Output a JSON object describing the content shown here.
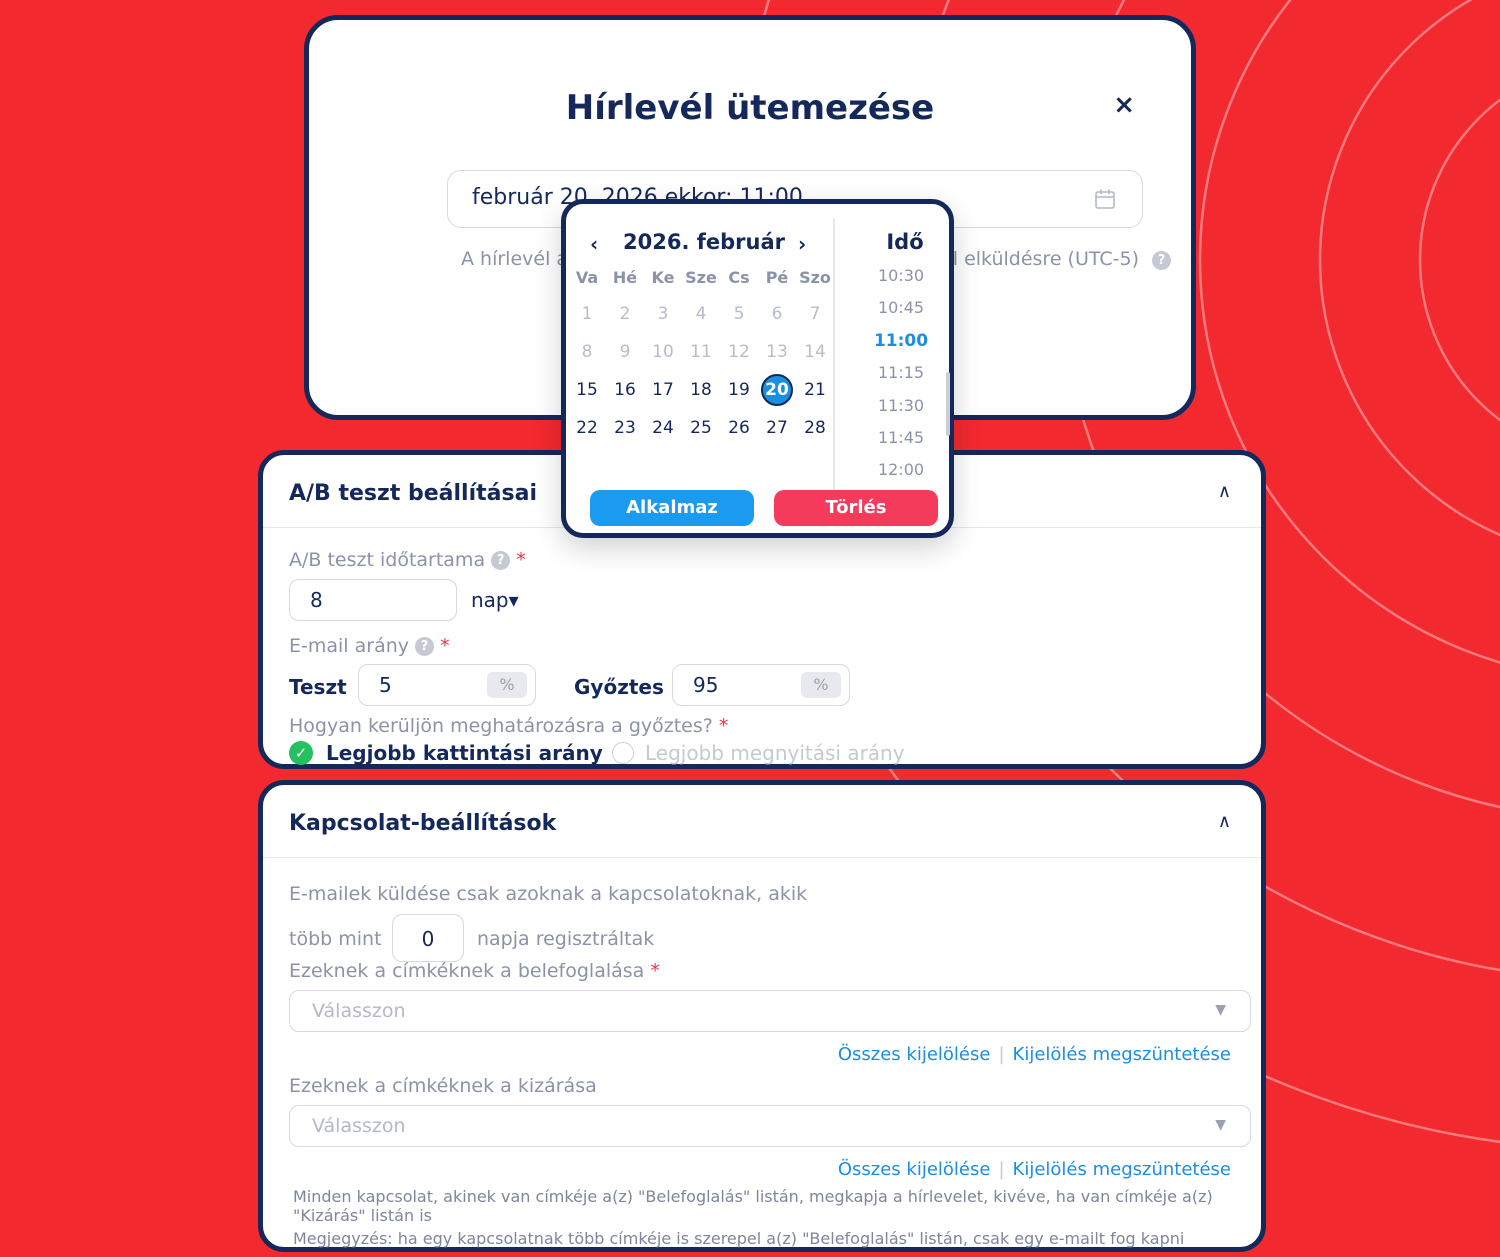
{
  "colors": {
    "background": "#f2292f",
    "navy": "#14285a",
    "accent_blue": "#1a8fe0",
    "danger": "#f43b5c",
    "success": "#25c060"
  },
  "modal": {
    "title": "Hírlevél ütemezése",
    "close_label": "×",
    "datetime_value": "február 20, 2026 ekkor: 11:00",
    "hint_left": "A hírlevél a",
    "hint_right": "ül elküldésre (UTC-5)",
    "help": "?"
  },
  "picker": {
    "prev": "‹",
    "next": "›",
    "month_title": "2026. február",
    "weekdays": [
      "Va",
      "Hé",
      "Ke",
      "Sze",
      "Cs",
      "Pé",
      "Szo"
    ],
    "weeks": [
      [
        "1",
        "2",
        "3",
        "4",
        "5",
        "6",
        "7"
      ],
      [
        "8",
        "9",
        "10",
        "11",
        "12",
        "13",
        "14"
      ],
      [
        "15",
        "16",
        "17",
        "18",
        "19",
        "20",
        "21"
      ],
      [
        "22",
        "23",
        "24",
        "25",
        "26",
        "27",
        "28"
      ]
    ],
    "muted_weeks": 2,
    "selected_day": "20",
    "time_title": "Idő",
    "times": [
      "10:30",
      "10:45",
      "11:00",
      "11:15",
      "11:30",
      "11:45",
      "12:00"
    ],
    "selected_time": "11:00",
    "apply_label": "Alkalmaz",
    "clear_label": "Törlés"
  },
  "ab_test": {
    "title": "A/B teszt beállításai",
    "duration_label": "A/B teszt időtartama",
    "duration_value": "8",
    "duration_unit": "nap▾",
    "ratio_label": "E-mail arány",
    "test_label": "Teszt",
    "test_value": "5",
    "winner_label": "Győztes",
    "winner_value": "95",
    "percent": "%",
    "winner_question": "Hogyan kerüljön meghatározásra a győztes?",
    "option_click": "Legjobb kattintási arány",
    "option_open": "Legjobb megnyitási arány",
    "required": "*",
    "help": "?"
  },
  "contacts": {
    "title": "Kapcsolat-beállítások",
    "intro": "E-mailek küldése csak azoknak a kapcsolatoknak, akik",
    "more_than": "több mint",
    "days_value": "0",
    "days_suffix": "napja regisztráltak",
    "include_label": "Ezeknek a címkéknek a belefoglalása",
    "include_placeholder": "Válasszon",
    "exclude_label": "Ezeknek a címkéknek a kizárása",
    "exclude_placeholder": "Válasszon",
    "select_all": "Összes kijelölése",
    "deselect_all": "Kijelölés megszüntetése",
    "separator": "|",
    "note_1": "Minden kapcsolat, akinek van címkéje a(z) \"Belefoglalás\" listán, megkapja a hírlevelet, kivéve, ha van címkéje a(z) \"Kizárás\" listán is",
    "note_2": "Megjegyzés: ha egy kapcsolatnak több címkéje is szerepel a(z) \"Belefoglalás\" listán, csak egy e-mailt fog kapni",
    "required": "*"
  }
}
